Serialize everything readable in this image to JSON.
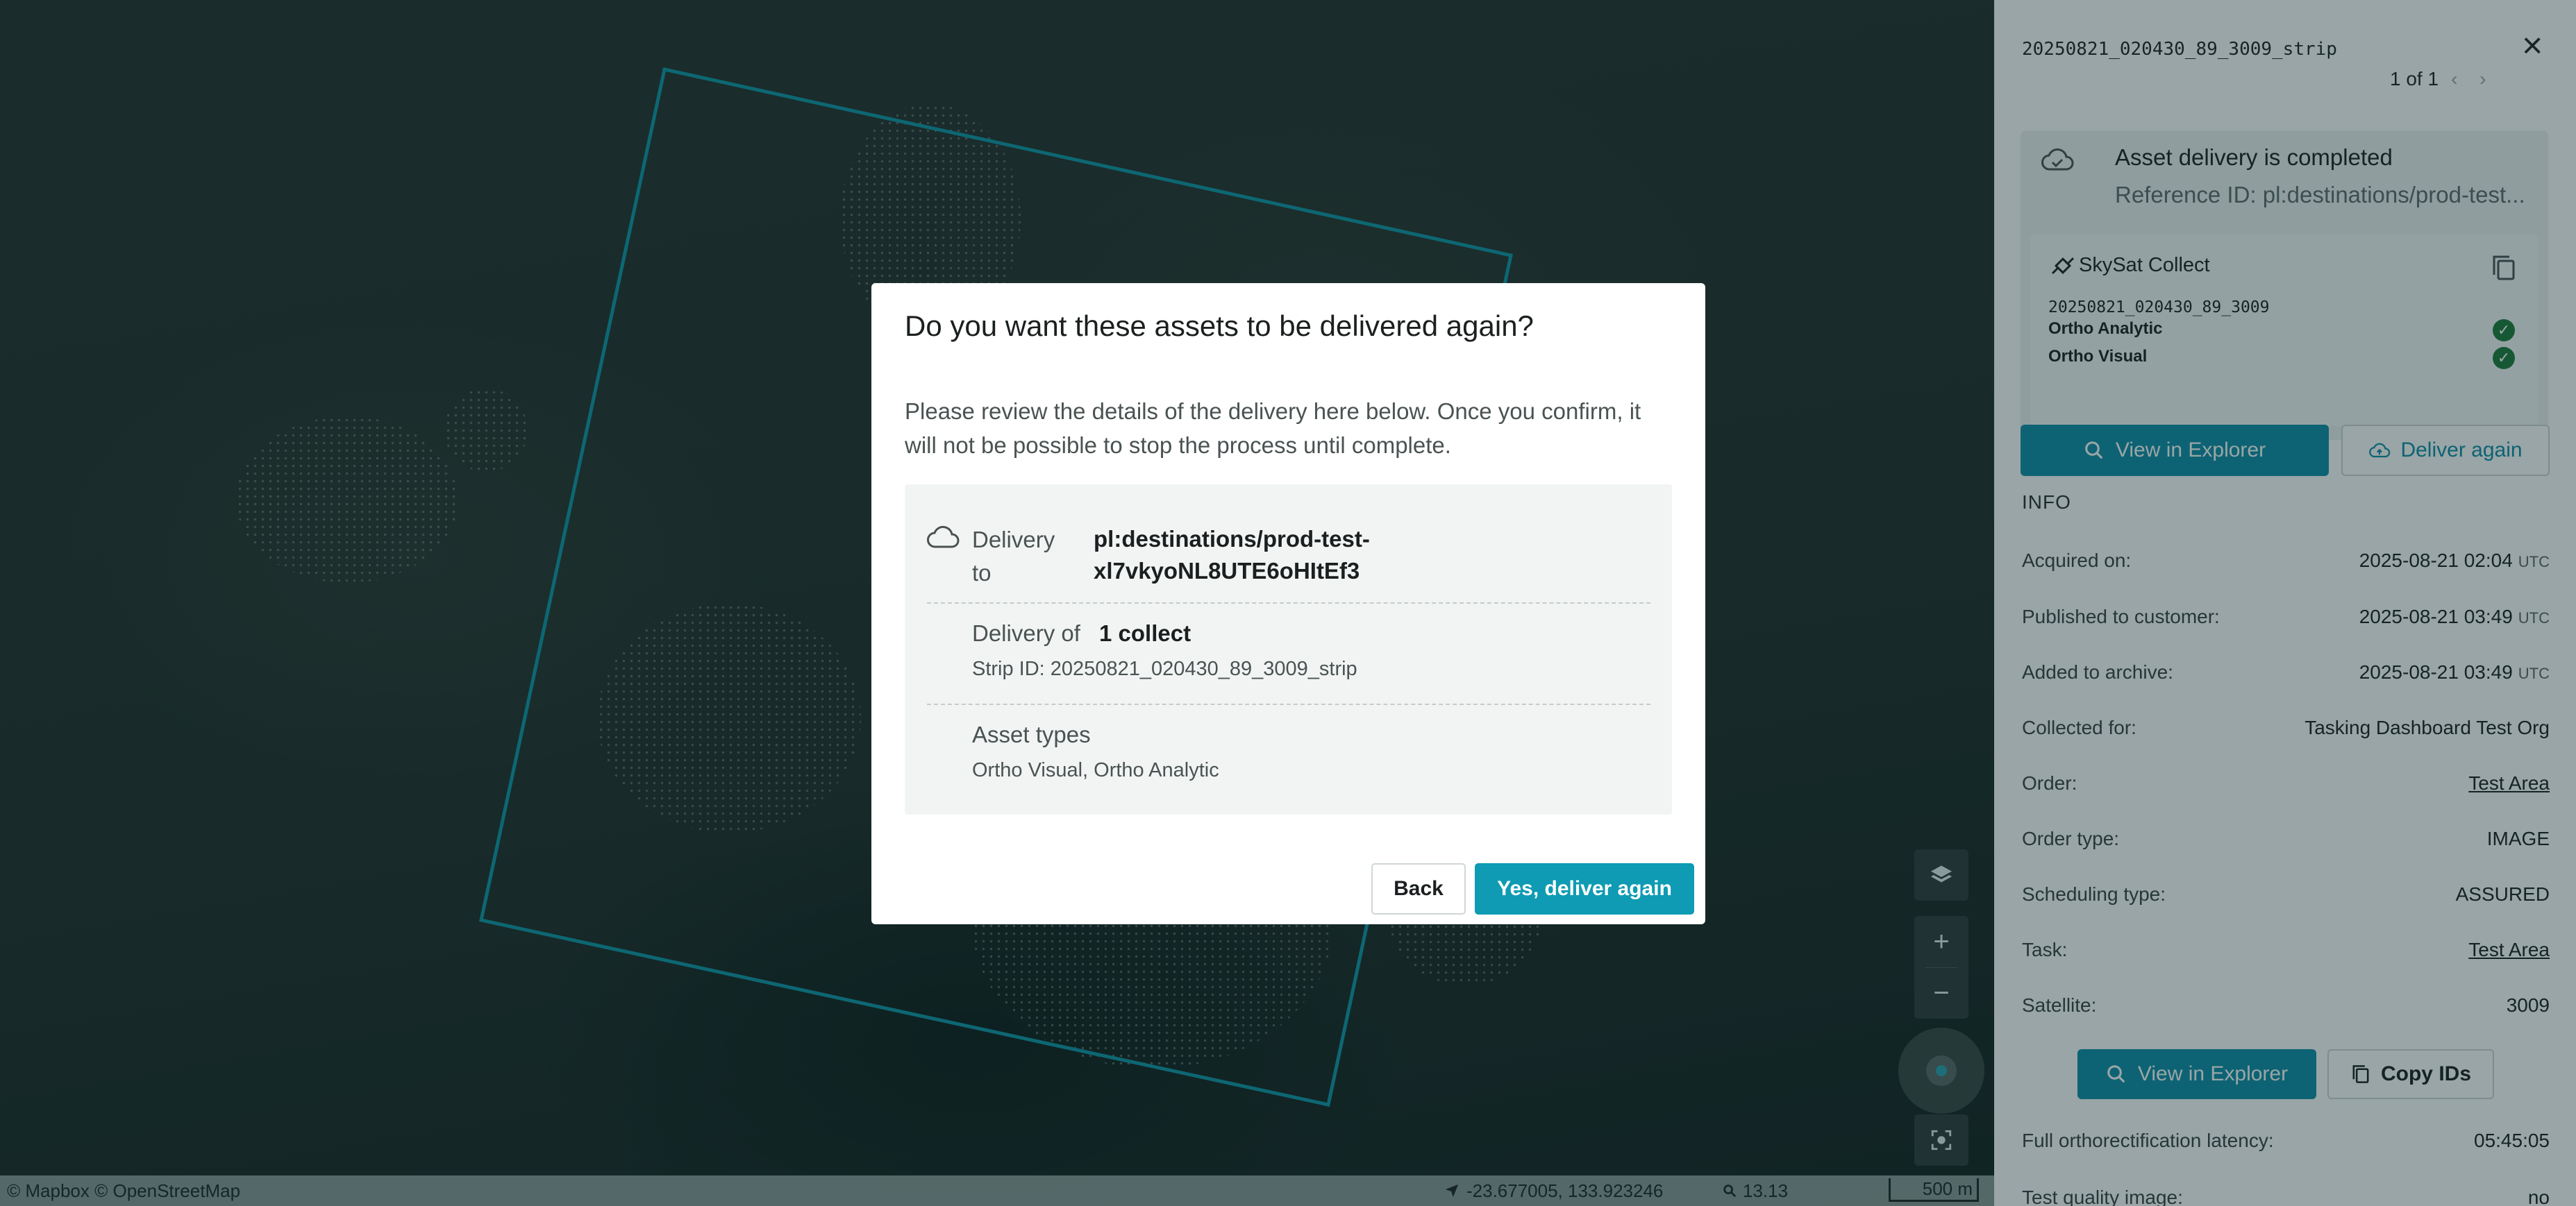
{
  "map": {
    "attribution": "© Mapbox © OpenStreetMap",
    "coordinates": "-23.677005, 133.923246",
    "zoom_level": "13.13",
    "scale": "500 m",
    "controls": {
      "layers_icon": "layers-icon",
      "zoom_in": "+",
      "zoom_out": "−"
    },
    "footprint_color": "#0e95a8"
  },
  "panel": {
    "strip_name": "20250821_020430_89_3009_strip",
    "pager": "1 of 1",
    "pager_arrows": "‹ ›",
    "status": {
      "title": "Asset delivery is completed",
      "reference": "Reference ID: pl:destinations/prod-test..."
    },
    "collect": {
      "name": "SkySat Collect",
      "strip_id": "20250821_020430_89_3009",
      "assets": [
        "Ortho Analytic",
        "Ortho Visual"
      ]
    },
    "buttons": {
      "view_in_explorer": "View in Explorer",
      "deliver_again": "Deliver again",
      "view_in_explorer_2": "View in Explorer",
      "copy_ids": "Copy IDs"
    },
    "info_heading": "INFO",
    "info": [
      {
        "label": "Acquired on:",
        "value": "2025-08-21 02:04",
        "suffix": "UTC"
      },
      {
        "label": "Published to customer:",
        "value": "2025-08-21 03:49",
        "suffix": "UTC"
      },
      {
        "label": "Added to archive:",
        "value": "2025-08-21 03:49",
        "suffix": "UTC"
      },
      {
        "label": "Collected for:",
        "value": "Tasking Dashboard Test Org"
      },
      {
        "label": "Order:",
        "value": "Test Area"
      },
      {
        "label": "Order type:",
        "value": "IMAGE"
      },
      {
        "label": "Scheduling type:",
        "value": "ASSURED"
      },
      {
        "label": "Task:",
        "value": "Test Area"
      },
      {
        "label": "Satellite:",
        "value": "3009"
      }
    ],
    "info_lower": [
      {
        "label": "Full orthorectification latency:",
        "value": "05:45:05"
      },
      {
        "label": "Test quality image:",
        "value": "no"
      }
    ]
  },
  "modal": {
    "title": "Do you want these assets to be delivered again?",
    "description": "Please review the details of the delivery here below. Once you confirm, it will not be possible to stop the process until complete.",
    "delivery_to_label": "Delivery to",
    "delivery_to_value": "pl:destinations/prod-test-xl7vkyoNL8UTE6oHItEf3",
    "delivery_of_label": "Delivery of",
    "delivery_of_value": "1 collect",
    "strip_id": "Strip ID: 20250821_020430_89_3009_strip",
    "asset_types_label": "Asset types",
    "asset_types_value": "Ortho Visual, Ortho Analytic",
    "back_label": "Back",
    "confirm_label": "Yes, deliver again"
  }
}
